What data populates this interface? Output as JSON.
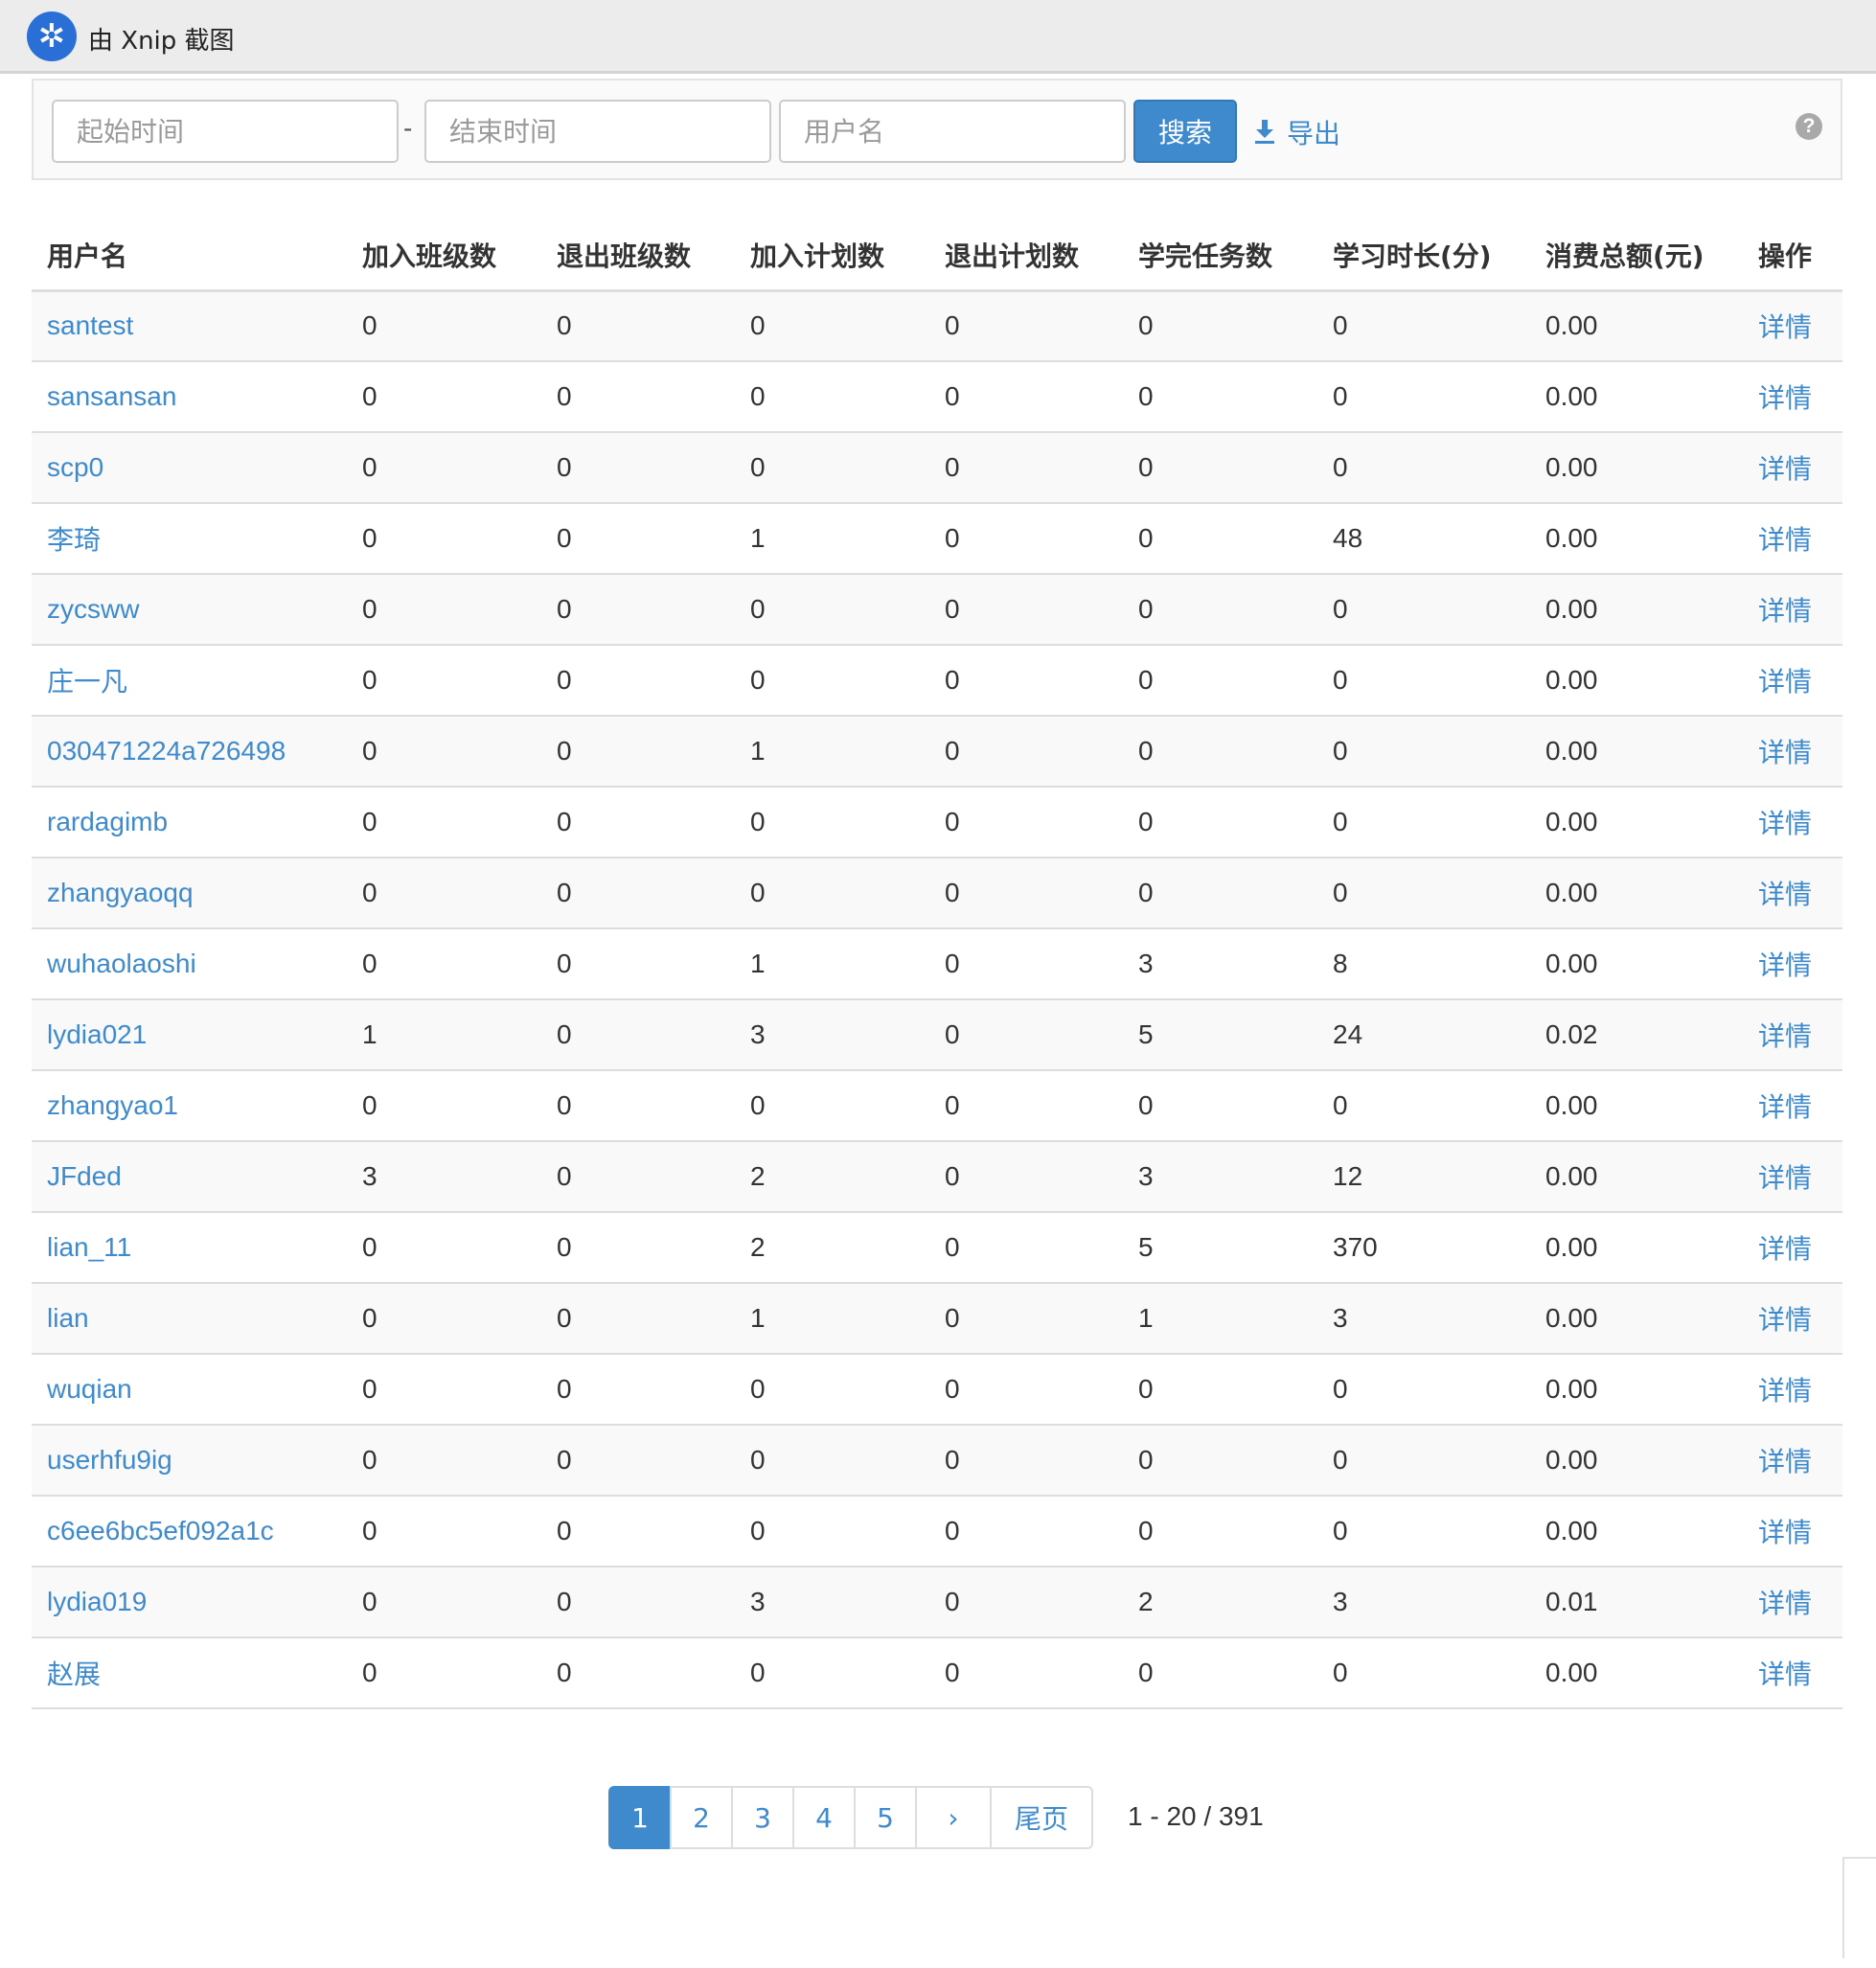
{
  "titlebar": {
    "title": "由 Xnip 截图",
    "logo_icon": "xnip-logo-icon"
  },
  "filters": {
    "start_placeholder": "起始时间",
    "separator": "-",
    "end_placeholder": "结束时间",
    "username_placeholder": "用户名",
    "search_label": "搜索",
    "export_label": "导出",
    "export_icon": "download-icon",
    "help_icon": "question-circle-icon"
  },
  "table": {
    "columns": [
      "用户名",
      "加入班级数",
      "退出班级数",
      "加入计划数",
      "退出计划数",
      "学完任务数",
      "学习时长(分)",
      "消费总额(元)",
      "操作"
    ],
    "rows": [
      {
        "username": "santest",
        "join_class": "0",
        "quit_class": "0",
        "join_plan": "0",
        "quit_plan": "0",
        "tasks_done": "0",
        "study_minutes": "0",
        "total_spent": "0.00",
        "action": "详情"
      },
      {
        "username": "sansansan",
        "join_class": "0",
        "quit_class": "0",
        "join_plan": "0",
        "quit_plan": "0",
        "tasks_done": "0",
        "study_minutes": "0",
        "total_spent": "0.00",
        "action": "详情"
      },
      {
        "username": "scp0",
        "join_class": "0",
        "quit_class": "0",
        "join_plan": "0",
        "quit_plan": "0",
        "tasks_done": "0",
        "study_minutes": "0",
        "total_spent": "0.00",
        "action": "详情"
      },
      {
        "username": "李琦",
        "join_class": "0",
        "quit_class": "0",
        "join_plan": "1",
        "quit_plan": "0",
        "tasks_done": "0",
        "study_minutes": "48",
        "total_spent": "0.00",
        "action": "详情"
      },
      {
        "username": "zycsww",
        "join_class": "0",
        "quit_class": "0",
        "join_plan": "0",
        "quit_plan": "0",
        "tasks_done": "0",
        "study_minutes": "0",
        "total_spent": "0.00",
        "action": "详情"
      },
      {
        "username": "庄一凡",
        "join_class": "0",
        "quit_class": "0",
        "join_plan": "0",
        "quit_plan": "0",
        "tasks_done": "0",
        "study_minutes": "0",
        "total_spent": "0.00",
        "action": "详情"
      },
      {
        "username": "030471224a726498",
        "join_class": "0",
        "quit_class": "0",
        "join_plan": "1",
        "quit_plan": "0",
        "tasks_done": "0",
        "study_minutes": "0",
        "total_spent": "0.00",
        "action": "详情"
      },
      {
        "username": "rardagimb",
        "join_class": "0",
        "quit_class": "0",
        "join_plan": "0",
        "quit_plan": "0",
        "tasks_done": "0",
        "study_minutes": "0",
        "total_spent": "0.00",
        "action": "详情"
      },
      {
        "username": "zhangyaoqq",
        "join_class": "0",
        "quit_class": "0",
        "join_plan": "0",
        "quit_plan": "0",
        "tasks_done": "0",
        "study_minutes": "0",
        "total_spent": "0.00",
        "action": "详情"
      },
      {
        "username": "wuhaolaoshi",
        "join_class": "0",
        "quit_class": "0",
        "join_plan": "1",
        "quit_plan": "0",
        "tasks_done": "3",
        "study_minutes": "8",
        "total_spent": "0.00",
        "action": "详情"
      },
      {
        "username": "lydia021",
        "join_class": "1",
        "quit_class": "0",
        "join_plan": "3",
        "quit_plan": "0",
        "tasks_done": "5",
        "study_minutes": "24",
        "total_spent": "0.02",
        "action": "详情"
      },
      {
        "username": "zhangyao1",
        "join_class": "0",
        "quit_class": "0",
        "join_plan": "0",
        "quit_plan": "0",
        "tasks_done": "0",
        "study_minutes": "0",
        "total_spent": "0.00",
        "action": "详情"
      },
      {
        "username": "JFded",
        "join_class": "3",
        "quit_class": "0",
        "join_plan": "2",
        "quit_plan": "0",
        "tasks_done": "3",
        "study_minutes": "12",
        "total_spent": "0.00",
        "action": "详情"
      },
      {
        "username": "lian_11",
        "join_class": "0",
        "quit_class": "0",
        "join_plan": "2",
        "quit_plan": "0",
        "tasks_done": "5",
        "study_minutes": "370",
        "total_spent": "0.00",
        "action": "详情"
      },
      {
        "username": "lian",
        "join_class": "0",
        "quit_class": "0",
        "join_plan": "1",
        "quit_plan": "0",
        "tasks_done": "1",
        "study_minutes": "3",
        "total_spent": "0.00",
        "action": "详情"
      },
      {
        "username": "wuqian",
        "join_class": "0",
        "quit_class": "0",
        "join_plan": "0",
        "quit_plan": "0",
        "tasks_done": "0",
        "study_minutes": "0",
        "total_spent": "0.00",
        "action": "详情"
      },
      {
        "username": "userhfu9ig",
        "join_class": "0",
        "quit_class": "0",
        "join_plan": "0",
        "quit_plan": "0",
        "tasks_done": "0",
        "study_minutes": "0",
        "total_spent": "0.00",
        "action": "详情"
      },
      {
        "username": "c6ee6bc5ef092a1c",
        "join_class": "0",
        "quit_class": "0",
        "join_plan": "0",
        "quit_plan": "0",
        "tasks_done": "0",
        "study_minutes": "0",
        "total_spent": "0.00",
        "action": "详情"
      },
      {
        "username": "lydia019",
        "join_class": "0",
        "quit_class": "0",
        "join_plan": "3",
        "quit_plan": "0",
        "tasks_done": "2",
        "study_minutes": "3",
        "total_spent": "0.01",
        "action": "详情"
      },
      {
        "username": "赵展",
        "join_class": "0",
        "quit_class": "0",
        "join_plan": "0",
        "quit_plan": "0",
        "tasks_done": "0",
        "study_minutes": "0",
        "total_spent": "0.00",
        "action": "详情"
      }
    ]
  },
  "pagination": {
    "pages": [
      "1",
      "2",
      "3",
      "4",
      "5"
    ],
    "active_page": "1",
    "next_label": "›",
    "last_label": "尾页",
    "summary": "1 - 20 / 391"
  },
  "colors": {
    "accent": "#3e8acc",
    "titlebar_bg": "#ececec",
    "row_stripe": "#f9f9f9",
    "border": "#dddddd"
  }
}
